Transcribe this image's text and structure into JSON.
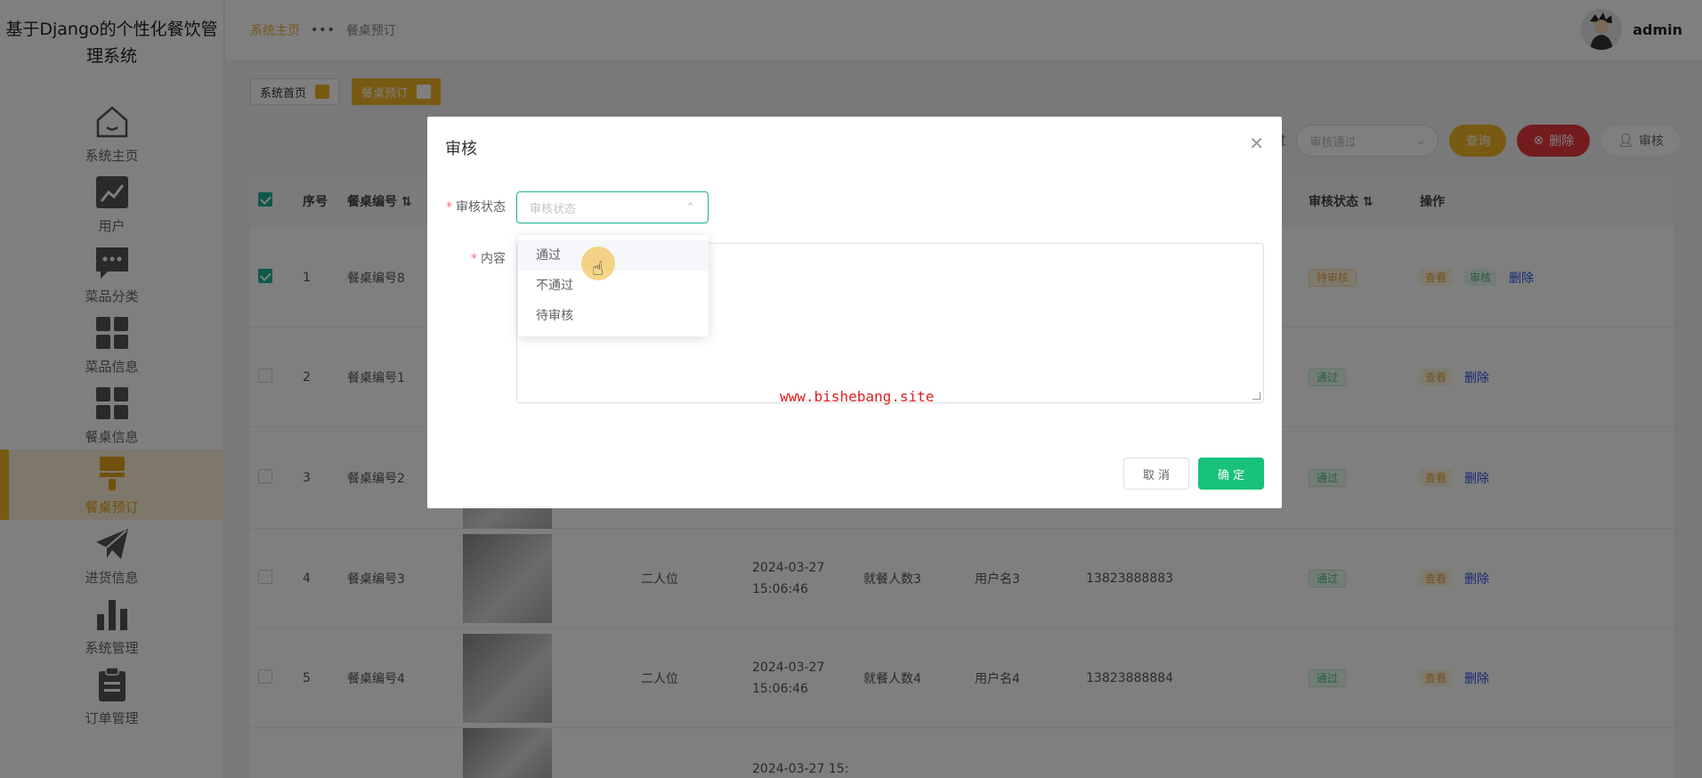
{
  "app": {
    "title": "基于Django的个性化餐饮管理系统"
  },
  "sidebar": {
    "items": [
      {
        "label": "系统主页",
        "icon": "home-icon"
      },
      {
        "label": "用户",
        "icon": "chart-line-icon"
      },
      {
        "label": "菜品分类",
        "icon": "chat-bubble-icon"
      },
      {
        "label": "菜品信息",
        "icon": "grid-icon"
      },
      {
        "label": "餐桌信息",
        "icon": "grid-icon"
      },
      {
        "label": "餐桌预订",
        "icon": "brush-icon"
      },
      {
        "label": "进货信息",
        "icon": "paper-plane-icon"
      },
      {
        "label": "系统管理",
        "icon": "bar-chart-icon"
      },
      {
        "label": "订单管理",
        "icon": "clipboard-icon"
      }
    ]
  },
  "header": {
    "breadcrumb": [
      "系统主页",
      "•••",
      "餐桌预订"
    ],
    "user": "admin"
  },
  "tags": [
    {
      "label": "系统首页"
    },
    {
      "label": "餐桌预订"
    }
  ],
  "toolbar": {
    "label": "过",
    "select_placeholder": "审核通过",
    "search": "查询",
    "delete": "删除",
    "audit": "审核"
  },
  "table": {
    "headers": [
      "序号",
      "餐桌编号",
      "审核状态",
      "操作"
    ],
    "rows": [
      {
        "no": "1",
        "code": "餐桌编号8",
        "type": "",
        "time": "",
        "people": "",
        "user": "",
        "phone": "",
        "status": "待审核",
        "ops": [
          "查看",
          "审核",
          "删除"
        ]
      },
      {
        "no": "2",
        "code": "餐桌编号1",
        "type": "",
        "time": "",
        "people": "",
        "user": "",
        "phone": "",
        "status": "通过",
        "ops": [
          "查看",
          "删除"
        ]
      },
      {
        "no": "3",
        "code": "餐桌编号2",
        "type": "",
        "time": "",
        "people": "",
        "user": "",
        "phone": "",
        "status": "通过",
        "ops": [
          "查看",
          "删除"
        ]
      },
      {
        "no": "4",
        "code": "餐桌编号3",
        "type": "二人位",
        "time": "2024-03-27 15:06:46",
        "people": "就餐人数3",
        "user": "用户名3",
        "phone": "13823888883",
        "status": "通过",
        "ops": [
          "查看",
          "删除"
        ]
      },
      {
        "no": "5",
        "code": "餐桌编号4",
        "type": "二人位",
        "time": "2024-03-27 15:06:46",
        "people": "就餐人数4",
        "user": "用户名4",
        "phone": "13823888884",
        "status": "通过",
        "ops": [
          "查看",
          "删除"
        ]
      },
      {
        "no": "",
        "code": "",
        "type": "",
        "time": "2024-03-27 15:",
        "people": "",
        "user": "",
        "phone": "",
        "status": "",
        "ops": []
      }
    ]
  },
  "modal": {
    "title": "审核",
    "status_label": "审核状态",
    "status_placeholder": "审核状态",
    "content_label": "内容",
    "options": [
      "通过",
      "不通过",
      "待审核"
    ],
    "cancel": "取 消",
    "confirm": "确 定"
  },
  "watermark": "www.bishebang.site",
  "colors": {
    "accent": "#f0b425",
    "primary": "#18c27a",
    "danger": "#e4393c"
  }
}
